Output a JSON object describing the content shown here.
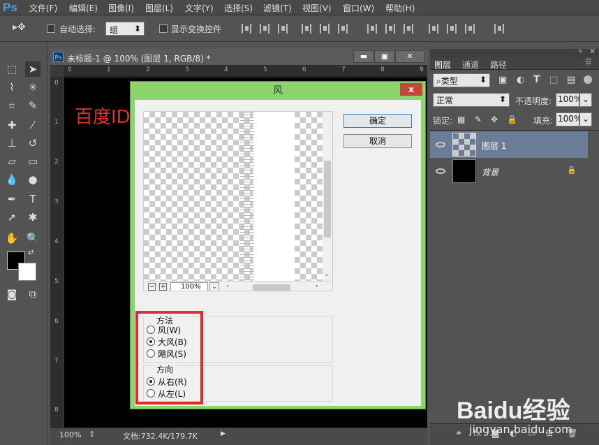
{
  "app": {
    "logo": "Ps"
  },
  "menubar": {
    "items": [
      "文件(F)",
      "编辑(E)",
      "图像(I)",
      "图层(L)",
      "文字(Y)",
      "选择(S)",
      "滤镜(T)",
      "视图(V)",
      "窗口(W)",
      "帮助(H)"
    ]
  },
  "options": {
    "auto_select_label": "自动选择:",
    "auto_select_value": "组",
    "show_transform_label": "显示变换控件"
  },
  "document": {
    "title": "未标题-1 @ 100% (图层 1, RGB/8) *",
    "watermark": "百度ID：sunnyMelody夏",
    "ruler_top": [
      "0",
      "1",
      "2",
      "3",
      "4",
      "5",
      "6",
      "7",
      "8",
      "9"
    ],
    "ruler_left": [
      "0",
      "1",
      "2",
      "3",
      "4",
      "5",
      "6",
      "7",
      "8"
    ]
  },
  "status": {
    "zoom": "100%",
    "doc_info": "文档:732.4K/179.7K"
  },
  "dialog": {
    "title": "风",
    "close": "x",
    "ok_label": "确定",
    "cancel_label": "取消",
    "zoom_value": "100%",
    "method_group": "方法",
    "methods": [
      "风(W)",
      "大风(B)",
      "飓风(S)"
    ],
    "method_selected": 1,
    "direction_group": "方向",
    "directions": [
      "从右(R)",
      "从左(L)"
    ],
    "direction_selected": 0
  },
  "panels": {
    "tabs": [
      "图层",
      "通道",
      "路径"
    ],
    "kind_filter": "类型",
    "blend_mode": "正常",
    "opacity_label": "不透明度:",
    "opacity_value": "100%",
    "lock_label": "锁定:",
    "fill_label": "填充:",
    "fill_value": "100%",
    "layers": [
      {
        "name": "图层 1"
      },
      {
        "name": "背景"
      }
    ]
  },
  "brand": {
    "logo": "Baidu经验",
    "url": "jingyan.baidu.com"
  }
}
